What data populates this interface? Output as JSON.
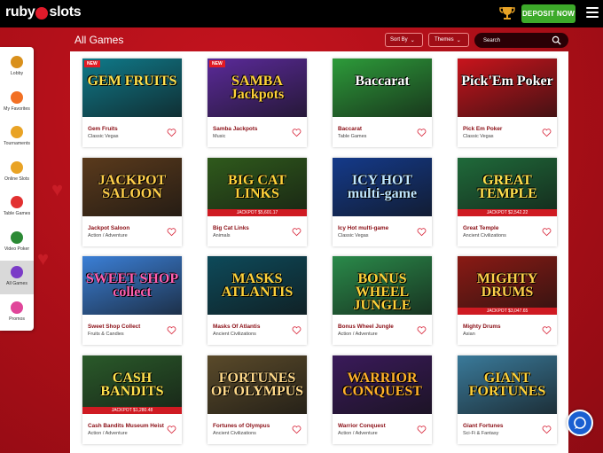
{
  "brand": {
    "logo_left": "ruby",
    "logo_right": "slots"
  },
  "topbar": {
    "deposit_label": "DEPOSIT NOW"
  },
  "sidebar": {
    "items": [
      {
        "label": "Lobby",
        "icon": "lobby-icon",
        "color": "#d9901c"
      },
      {
        "label": "My Favorites",
        "icon": "heart-icon",
        "color": "#f27024"
      },
      {
        "label": "Tournaments",
        "icon": "trophy-icon",
        "color": "#e9a325"
      },
      {
        "label": "Online Slots",
        "icon": "slot-machine-icon",
        "color": "#e9a325"
      },
      {
        "label": "Table Games",
        "icon": "dice-icon",
        "color": "#e23030"
      },
      {
        "label": "Video Poker",
        "icon": "cards-icon",
        "color": "#2c8a35"
      },
      {
        "label": "All Games",
        "icon": "all-games-icon",
        "color": "#7b3bc7"
      },
      {
        "label": "Promos",
        "icon": "gift-icon",
        "color": "#e0469a"
      }
    ]
  },
  "main": {
    "title": "All Games",
    "sort_label": "Sort By",
    "themes_label": "Themes",
    "search_placeholder": "Search"
  },
  "games": [
    {
      "name": "Gem Fruits",
      "category": "Classic Vegas",
      "badge": "NEW",
      "thumb_text": "GEM FRUITS",
      "bg": "#0f7a8a",
      "fg": "#ffe14d"
    },
    {
      "name": "Samba Jackpots",
      "category": "Music",
      "badge": "NEW",
      "thumb_text": "SAMBA Jackpots",
      "bg": "#5b2a9a",
      "fg": "#ffd23a"
    },
    {
      "name": "Baccarat",
      "category": "Table Games",
      "thumb_text": "Baccarat",
      "bg": "#2d9b3a",
      "fg": "#ffffff"
    },
    {
      "name": "Pick Em Poker",
      "category": "Classic Vegas",
      "thumb_text": "Pick'Em Poker",
      "bg": "#c8141c",
      "fg": "#ffffff"
    },
    {
      "name": "Jackpot Saloon",
      "category": "Action / Adventure",
      "thumb_text": "JACKPOT SALOON",
      "bg": "#5a3a1c",
      "fg": "#ffcf4a"
    },
    {
      "name": "Big Cat Links",
      "category": "Animals",
      "jackpot": "JACKPOT $5,601.17",
      "thumb_text": "BIG CAT LINKS",
      "bg": "#2f5a1c",
      "fg": "#ffd23a"
    },
    {
      "name": "Icy Hot multi-game",
      "category": "Classic Vegas",
      "thumb_text": "ICY HOT multi-game",
      "bg": "#143a8a",
      "fg": "#bfe6ff"
    },
    {
      "name": "Great Temple",
      "category": "Ancient Civilizations",
      "jackpot": "JACKPOT $2,542.22",
      "thumb_text": "GREAT TEMPLE",
      "bg": "#1f6a3a",
      "fg": "#ffe14d"
    },
    {
      "name": "Sweet Shop Collect",
      "category": "Fruits & Candies",
      "thumb_text": "SWEET SHOP collect",
      "bg": "#3b7fd6",
      "fg": "#ff5fb0"
    },
    {
      "name": "Masks Of Atlantis",
      "category": "Ancient Civilizations",
      "thumb_text": "MASKS ATLANTIS",
      "bg": "#0d4a5a",
      "fg": "#ffd23a"
    },
    {
      "name": "Bonus Wheel Jungle",
      "category": "Action / Adventure",
      "thumb_text": "BONUS WHEEL JUNGLE",
      "bg": "#2a8a4a",
      "fg": "#ffd23a"
    },
    {
      "name": "Mighty Drums",
      "category": "Asian",
      "jackpot": "JACKPOT $3,047.65",
      "thumb_text": "MIGHTY DRUMS",
      "bg": "#8a1a14",
      "fg": "#ffcf4a"
    },
    {
      "name": "Cash Bandits Museum Heist",
      "category": "Action / Adventure",
      "jackpot": "JACKPOT $1,280.48",
      "thumb_text": "CASH BANDITS",
      "bg": "#2a5a2a",
      "fg": "#ffe14d"
    },
    {
      "name": "Fortunes of Olympus",
      "category": "Ancient Civilizations",
      "thumb_text": "FORTUNES OF OLYMPUS",
      "bg": "#5a4a2a",
      "fg": "#ffd98a"
    },
    {
      "name": "Warrior Conquest",
      "category": "Action / Adventure",
      "thumb_text": "WARRIOR CONQUEST",
      "bg": "#3a1a5a",
      "fg": "#ffb02a"
    },
    {
      "name": "Giant Fortunes",
      "category": "Sci-Fi & Fantasy",
      "thumb_text": "GIANT FORTUNES",
      "bg": "#3a7a9a",
      "fg": "#ffd23a"
    }
  ]
}
